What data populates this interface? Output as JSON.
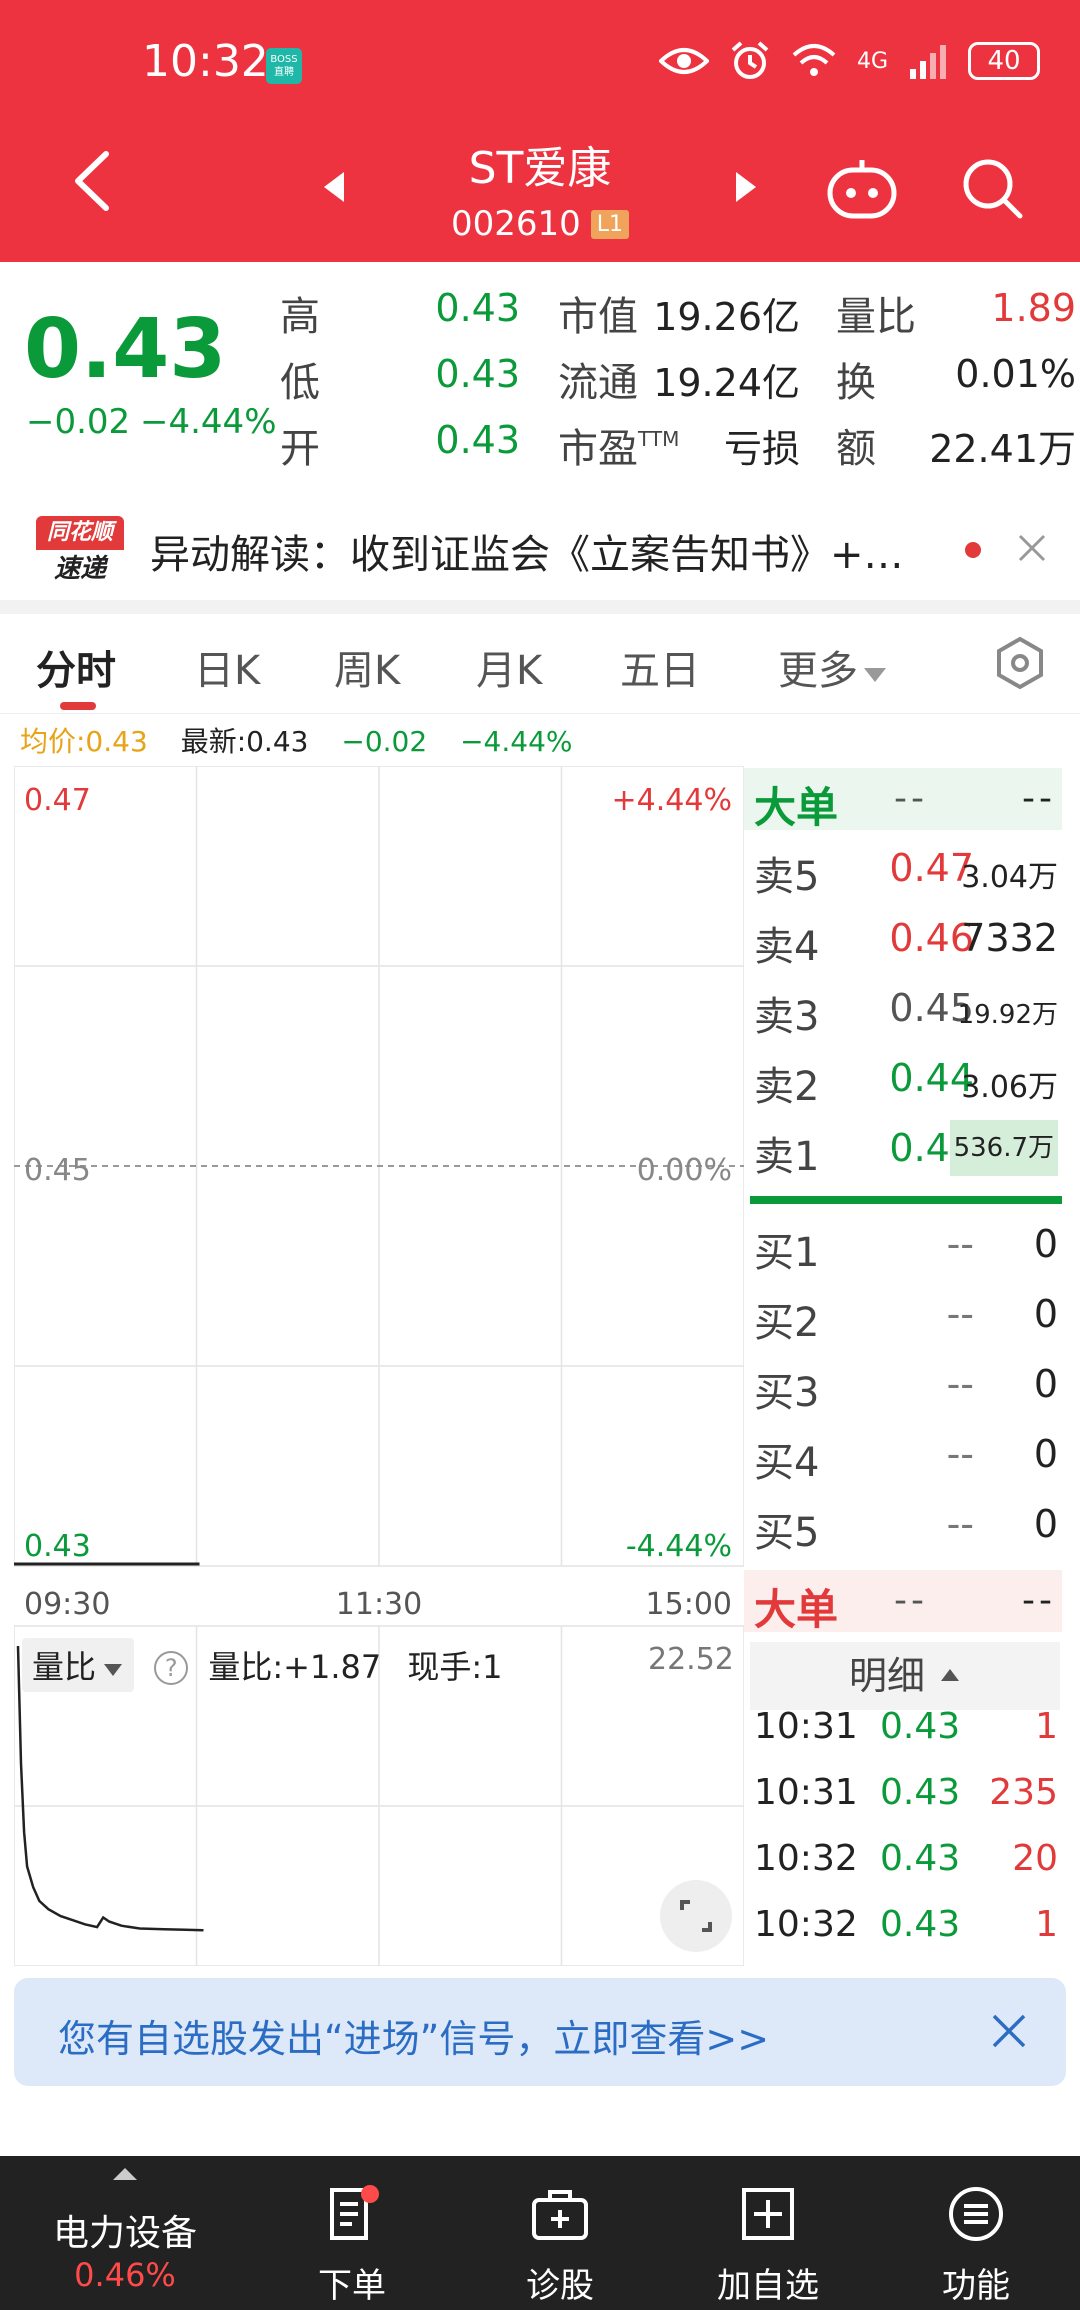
{
  "status": {
    "time": "10:32",
    "boss_badge": "BOSS直聘",
    "network": "4G",
    "battery": "40"
  },
  "header": {
    "name": "ST爱康",
    "code": "002610",
    "level": "L1"
  },
  "quote": {
    "price": "0.43",
    "change": "−0.02",
    "change_pct": "−4.44%",
    "high_label": "高",
    "high": "0.43",
    "low_label": "低",
    "low": "0.43",
    "open_label": "开",
    "open": "0.43",
    "mcap_label": "市值",
    "mcap": "19.26亿",
    "float_label": "流通",
    "float": "19.24亿",
    "pe_label": "市盈",
    "pe_sup": "TTM",
    "pe": "亏损",
    "vr_label": "量比",
    "vr": "1.89",
    "turnover_label": "换",
    "turnover": "0.01%",
    "amount_label": "额",
    "amount": "22.41万"
  },
  "alert": {
    "logo_top": "同花顺",
    "logo_bottom": "速递",
    "text": "异动解读：收到证监会《立案告知书》+…"
  },
  "tabs": {
    "t1": "分时",
    "t2": "日K",
    "t3": "周K",
    "t4": "月K",
    "t5": "五日",
    "more": "更多"
  },
  "summary": {
    "avg": "均价:0.43",
    "latest": "最新:0.43",
    "chg": "−0.02",
    "pct": "−4.44%"
  },
  "chart_data": {
    "type": "line",
    "title": "",
    "y_left_labels": [
      "0.47",
      "0.45",
      "0.43"
    ],
    "y_right_labels": [
      "+4.44%",
      "0.00%",
      "-4.44%"
    ],
    "ylim": [
      0.43,
      0.47
    ],
    "prev_close": 0.45,
    "x_labels": [
      "09:30",
      "11:30",
      "15:00"
    ],
    "price_series": {
      "x_minutes": [
        0,
        61
      ],
      "y": [
        0.43,
        0.43
      ]
    },
    "volume_ratio": {
      "label": "量比",
      "value_text": "量比:+1.87",
      "hand_text": "现手:1",
      "ymax_text": "22.52",
      "ymax": 22.52,
      "x_minutes": [
        0,
        1,
        2,
        3,
        5,
        7,
        10,
        14,
        18,
        22,
        26,
        28,
        30,
        34,
        40,
        48,
        55,
        61
      ],
      "y": [
        22.52,
        14,
        9,
        6.5,
        5,
        4,
        3.4,
        2.9,
        2.6,
        2.3,
        2.1,
        2.8,
        2.5,
        2.2,
        2.0,
        1.95,
        1.9,
        1.87
      ]
    }
  },
  "orderbook": {
    "big_top": {
      "label": "大单",
      "v1": "--",
      "v2": "--"
    },
    "asks": [
      {
        "label": "卖5",
        "price": "0.47",
        "vol": "3.04万"
      },
      {
        "label": "卖4",
        "price": "0.46",
        "vol": "7332"
      },
      {
        "label": "卖3",
        "price": "0.45",
        "vol": "19.92万"
      },
      {
        "label": "卖2",
        "price": "0.44",
        "vol": "3.06万"
      },
      {
        "label": "卖1",
        "price": "0.43",
        "vol": "536.7万"
      }
    ],
    "bids": [
      {
        "label": "买1",
        "price": "--",
        "vol": "0"
      },
      {
        "label": "买2",
        "price": "--",
        "vol": "0"
      },
      {
        "label": "买3",
        "price": "--",
        "vol": "0"
      },
      {
        "label": "买4",
        "price": "--",
        "vol": "0"
      },
      {
        "label": "买5",
        "price": "--",
        "vol": "0"
      }
    ],
    "big_bottom": {
      "label": "大单",
      "v1": "--",
      "v2": "--"
    }
  },
  "ticks": {
    "header": "明细",
    "rows": [
      {
        "time": "10:31",
        "price": "0.43",
        "vol": "1"
      },
      {
        "time": "10:31",
        "price": "0.43",
        "vol": "235"
      },
      {
        "time": "10:32",
        "price": "0.43",
        "vol": "20"
      },
      {
        "time": "10:32",
        "price": "0.43",
        "vol": "1"
      }
    ]
  },
  "signal": {
    "text": "您有自选股发出“进场”信号，立即查看>>"
  },
  "bottom": {
    "sector_name": "电力设备",
    "sector_change": "0.46%",
    "order": "下单",
    "diagnose": "诊股",
    "add_watch": "加自选",
    "functions": "功能"
  },
  "colors": {
    "header_red": "#ee3340",
    "down_green": "#0a9a3a",
    "up_red": "#e23a3a",
    "avg_orange": "#e8a317",
    "signal_blue": "#2b6cc4"
  }
}
